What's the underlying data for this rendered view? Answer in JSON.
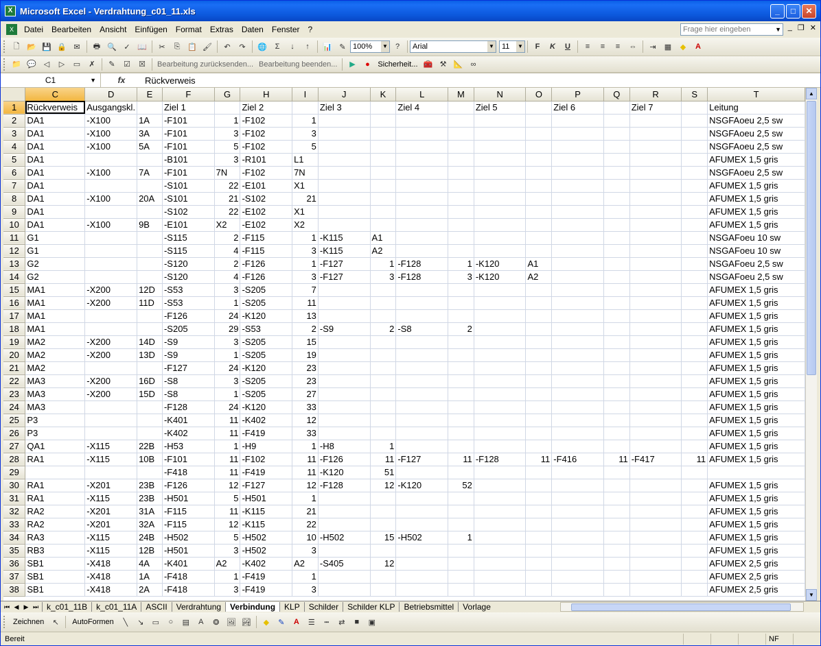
{
  "window": {
    "title": "Microsoft Excel - Verdrahtung_c01_11.xls",
    "app_icon": "X"
  },
  "menu": {
    "items": [
      "Datei",
      "Bearbeiten",
      "Ansicht",
      "Einfügen",
      "Format",
      "Extras",
      "Daten",
      "Fenster",
      "?"
    ],
    "help_placeholder": "Frage hier eingeben"
  },
  "toolbar": {
    "zoom": "100%",
    "font": "Arial",
    "font_size": "11",
    "bold": "F",
    "italic": "K",
    "underline": "U"
  },
  "review_toolbar": {
    "reply_changes": "Bearbeitung zurücksenden...",
    "end_review": "Bearbeitung beenden...",
    "security": "Sicherheit..."
  },
  "formula_bar": {
    "name_box": "C1",
    "fx": "fx",
    "content": "Rückverweis"
  },
  "columns": [
    "C",
    "D",
    "E",
    "F",
    "G",
    "H",
    "I",
    "J",
    "K",
    "L",
    "M",
    "N",
    "O",
    "P",
    "Q",
    "R",
    "S",
    "T"
  ],
  "rows": [
    {
      "n": "1",
      "c": [
        "Rückverweis",
        "Ausgangskl.",
        "",
        "Ziel 1",
        "",
        "Ziel 2",
        "",
        "Ziel 3",
        "",
        "Ziel 4",
        "",
        "Ziel 5",
        "",
        "Ziel 6",
        "",
        "Ziel 7",
        "",
        "Leitung"
      ]
    },
    {
      "n": "2",
      "c": [
        "DA1",
        "-X100",
        "1A",
        "-F101",
        "1",
        "-F102",
        "1",
        "",
        "",
        "",
        "",
        "",
        "",
        "",
        "",
        "",
        "",
        "NSGFAoeu 2,5 sw"
      ]
    },
    {
      "n": "3",
      "c": [
        "DA1",
        "-X100",
        "3A",
        "-F101",
        "3",
        "-F102",
        "3",
        "",
        "",
        "",
        "",
        "",
        "",
        "",
        "",
        "",
        "",
        "NSGFAoeu 2,5 sw"
      ]
    },
    {
      "n": "4",
      "c": [
        "DA1",
        "-X100",
        "5A",
        "-F101",
        "5",
        "-F102",
        "5",
        "",
        "",
        "",
        "",
        "",
        "",
        "",
        "",
        "",
        "",
        "NSGFAoeu 2,5 sw"
      ]
    },
    {
      "n": "5",
      "c": [
        "DA1",
        "",
        "",
        "-B101",
        "3",
        "-R101",
        "L1",
        "",
        "",
        "",
        "",
        "",
        "",
        "",
        "",
        "",
        "",
        "AFUMEX 1,5 gris"
      ]
    },
    {
      "n": "6",
      "c": [
        "DA1",
        "-X100",
        "7A",
        "-F101",
        "7N",
        "-F102",
        "7N",
        "",
        "",
        "",
        "",
        "",
        "",
        "",
        "",
        "",
        "",
        "NSGFAoeu 2,5 sw"
      ]
    },
    {
      "n": "7",
      "c": [
        "DA1",
        "",
        "",
        "-S101",
        "22",
        "-E101",
        "X1",
        "",
        "",
        "",
        "",
        "",
        "",
        "",
        "",
        "",
        "",
        "AFUMEX 1,5 gris"
      ]
    },
    {
      "n": "8",
      "c": [
        "DA1",
        "-X100",
        "20A",
        "-S101",
        "21",
        "-S102",
        "21",
        "",
        "",
        "",
        "",
        "",
        "",
        "",
        "",
        "",
        "",
        "AFUMEX 1,5 gris"
      ]
    },
    {
      "n": "9",
      "c": [
        "DA1",
        "",
        "",
        "-S102",
        "22",
        "-E102",
        "X1",
        "",
        "",
        "",
        "",
        "",
        "",
        "",
        "",
        "",
        "",
        "AFUMEX 1,5 gris"
      ]
    },
    {
      "n": "10",
      "c": [
        "DA1",
        "-X100",
        "9B",
        "-E101",
        "X2",
        "-E102",
        "X2",
        "",
        "",
        "",
        "",
        "",
        "",
        "",
        "",
        "",
        "",
        "AFUMEX 1,5 gris"
      ]
    },
    {
      "n": "11",
      "c": [
        "G1",
        "",
        "",
        "-S115",
        "2",
        "-F115",
        "1",
        "-K115",
        "A1",
        "",
        "",
        "",
        "",
        "",
        "",
        "",
        "",
        "NSGAFoeu 10 sw"
      ]
    },
    {
      "n": "12",
      "c": [
        "G1",
        "",
        "",
        "-S115",
        "4",
        "-F115",
        "3",
        "-K115",
        "A2",
        "",
        "",
        "",
        "",
        "",
        "",
        "",
        "",
        "NSGAFoeu 10 sw"
      ]
    },
    {
      "n": "13",
      "c": [
        "G2",
        "",
        "",
        "-S120",
        "2",
        "-F126",
        "1",
        "-F127",
        "1",
        "-F128",
        "1",
        "-K120",
        "A1",
        "",
        "",
        "",
        "",
        "NSGAFoeu 2,5 sw"
      ]
    },
    {
      "n": "14",
      "c": [
        "G2",
        "",
        "",
        "-S120",
        "4",
        "-F126",
        "3",
        "-F127",
        "3",
        "-F128",
        "3",
        "-K120",
        "A2",
        "",
        "",
        "",
        "",
        "NSGAFoeu 2,5 sw"
      ]
    },
    {
      "n": "15",
      "c": [
        "MA1",
        "-X200",
        "12D",
        "-S53",
        "3",
        "-S205",
        "7",
        "",
        "",
        "",
        "",
        "",
        "",
        "",
        "",
        "",
        "",
        "AFUMEX 1,5 gris"
      ]
    },
    {
      "n": "16",
      "c": [
        "MA1",
        "-X200",
        "11D",
        "-S53",
        "1",
        "-S205",
        "11",
        "",
        "",
        "",
        "",
        "",
        "",
        "",
        "",
        "",
        "",
        "AFUMEX 1,5 gris"
      ]
    },
    {
      "n": "17",
      "c": [
        "MA1",
        "",
        "",
        "-F126",
        "24",
        "-K120",
        "13",
        "",
        "",
        "",
        "",
        "",
        "",
        "",
        "",
        "",
        "",
        "AFUMEX 1,5 gris"
      ]
    },
    {
      "n": "18",
      "c": [
        "MA1",
        "",
        "",
        "-S205",
        "29",
        "-S53",
        "2",
        "-S9",
        "2",
        "-S8",
        "2",
        "",
        "",
        "",
        "",
        "",
        "",
        "AFUMEX 1,5 gris"
      ]
    },
    {
      "n": "19",
      "c": [
        "MA2",
        "-X200",
        "14D",
        "-S9",
        "3",
        "-S205",
        "15",
        "",
        "",
        "",
        "",
        "",
        "",
        "",
        "",
        "",
        "",
        "AFUMEX 1,5 gris"
      ]
    },
    {
      "n": "20",
      "c": [
        "MA2",
        "-X200",
        "13D",
        "-S9",
        "1",
        "-S205",
        "19",
        "",
        "",
        "",
        "",
        "",
        "",
        "",
        "",
        "",
        "",
        "AFUMEX 1,5 gris"
      ]
    },
    {
      "n": "21",
      "c": [
        "MA2",
        "",
        "",
        "-F127",
        "24",
        "-K120",
        "23",
        "",
        "",
        "",
        "",
        "",
        "",
        "",
        "",
        "",
        "",
        "AFUMEX 1,5 gris"
      ]
    },
    {
      "n": "22",
      "c": [
        "MA3",
        "-X200",
        "16D",
        "-S8",
        "3",
        "-S205",
        "23",
        "",
        "",
        "",
        "",
        "",
        "",
        "",
        "",
        "",
        "",
        "AFUMEX 1,5 gris"
      ]
    },
    {
      "n": "23",
      "c": [
        "MA3",
        "-X200",
        "15D",
        "-S8",
        "1",
        "-S205",
        "27",
        "",
        "",
        "",
        "",
        "",
        "",
        "",
        "",
        "",
        "",
        "AFUMEX 1,5 gris"
      ]
    },
    {
      "n": "24",
      "c": [
        "MA3",
        "",
        "",
        "-F128",
        "24",
        "-K120",
        "33",
        "",
        "",
        "",
        "",
        "",
        "",
        "",
        "",
        "",
        "",
        "AFUMEX 1,5 gris"
      ]
    },
    {
      "n": "25",
      "c": [
        "P3",
        "",
        "",
        "-K401",
        "11",
        "-K402",
        "12",
        "",
        "",
        "",
        "",
        "",
        "",
        "",
        "",
        "",
        "",
        "AFUMEX 1,5 gris"
      ]
    },
    {
      "n": "26",
      "c": [
        "P3",
        "",
        "",
        "-K402",
        "11",
        "-F419",
        "33",
        "",
        "",
        "",
        "",
        "",
        "",
        "",
        "",
        "",
        "",
        "AFUMEX 1,5 gris"
      ]
    },
    {
      "n": "27",
      "c": [
        "QA1",
        "-X115",
        "22B",
        "-H53",
        "1",
        "-H9",
        "1",
        "-H8",
        "1",
        "",
        "",
        "",
        "",
        "",
        "",
        "",
        "",
        "AFUMEX 1,5 gris"
      ]
    },
    {
      "n": "28",
      "c": [
        "RA1",
        "-X115",
        "10B",
        "-F101",
        "11",
        "-F102",
        "11",
        "-F126",
        "11",
        "-F127",
        "11",
        "-F128",
        "11",
        "-F416",
        "11",
        "-F417",
        "11",
        "AFUMEX 1,5 gris"
      ]
    },
    {
      "n": "29",
      "c": [
        "",
        "",
        "",
        "-F418",
        "11",
        "-F419",
        "11",
        "-K120",
        "51",
        "",
        "",
        "",
        "",
        "",
        "",
        "",
        "",
        ""
      ]
    },
    {
      "n": "30",
      "c": [
        "RA1",
        "-X201",
        "23B",
        "-F126",
        "12",
        "-F127",
        "12",
        "-F128",
        "12",
        "-K120",
        "52",
        "",
        "",
        "",
        "",
        "",
        "",
        "AFUMEX 1,5 gris"
      ]
    },
    {
      "n": "31",
      "c": [
        "RA1",
        "-X115",
        "23B",
        "-H501",
        "5",
        "-H501",
        "1",
        "",
        "",
        "",
        "",
        "",
        "",
        "",
        "",
        "",
        "",
        "AFUMEX 1,5 gris"
      ]
    },
    {
      "n": "32",
      "c": [
        "RA2",
        "-X201",
        "31A",
        "-F115",
        "11",
        "-K115",
        "21",
        "",
        "",
        "",
        "",
        "",
        "",
        "",
        "",
        "",
        "",
        "AFUMEX 1,5 gris"
      ]
    },
    {
      "n": "33",
      "c": [
        "RA2",
        "-X201",
        "32A",
        "-F115",
        "12",
        "-K115",
        "22",
        "",
        "",
        "",
        "",
        "",
        "",
        "",
        "",
        "",
        "",
        "AFUMEX 1,5 gris"
      ]
    },
    {
      "n": "34",
      "c": [
        "RA3",
        "-X115",
        "24B",
        "-H502",
        "5",
        "-H502",
        "10",
        "-H502",
        "15",
        "-H502",
        "1",
        "",
        "",
        "",
        "",
        "",
        "",
        "AFUMEX 1,5 gris"
      ]
    },
    {
      "n": "35",
      "c": [
        "RB3",
        "-X115",
        "12B",
        "-H501",
        "3",
        "-H502",
        "3",
        "",
        "",
        "",
        "",
        "",
        "",
        "",
        "",
        "",
        "",
        "AFUMEX 1,5 gris"
      ]
    },
    {
      "n": "36",
      "c": [
        "SB1",
        "-X418",
        "4A",
        "-K401",
        "A2",
        "-K402",
        "A2",
        "-S405",
        "12",
        "",
        "",
        "",
        "",
        "",
        "",
        "",
        "",
        "AFUMEX 2,5 gris"
      ]
    },
    {
      "n": "37",
      "c": [
        "SB1",
        "-X418",
        "1A",
        "-F418",
        "1",
        "-F419",
        "1",
        "",
        "",
        "",
        "",
        "",
        "",
        "",
        "",
        "",
        "",
        "AFUMEX 2,5 gris"
      ]
    },
    {
      "n": "38",
      "c": [
        "SB1",
        "-X418",
        "2A",
        "-F418",
        "3",
        "-F419",
        "3",
        "",
        "",
        "",
        "",
        "",
        "",
        "",
        "",
        "",
        "",
        "AFUMEX 2,5 gris"
      ]
    }
  ],
  "sheet_tabs": [
    "k_c01_11B",
    "k_c01_11A",
    "ASCII",
    "Verdrahtung",
    "Verbindung",
    "KLP",
    "Schilder",
    "Schilder KLP",
    "Betriebsmittel",
    "Vorlage"
  ],
  "active_tab": "Verbindung",
  "drawing_toolbar": {
    "draw": "Zeichnen",
    "autoshapes": "AutoFormen"
  },
  "status": {
    "text": "Bereit",
    "nf": "NF"
  }
}
